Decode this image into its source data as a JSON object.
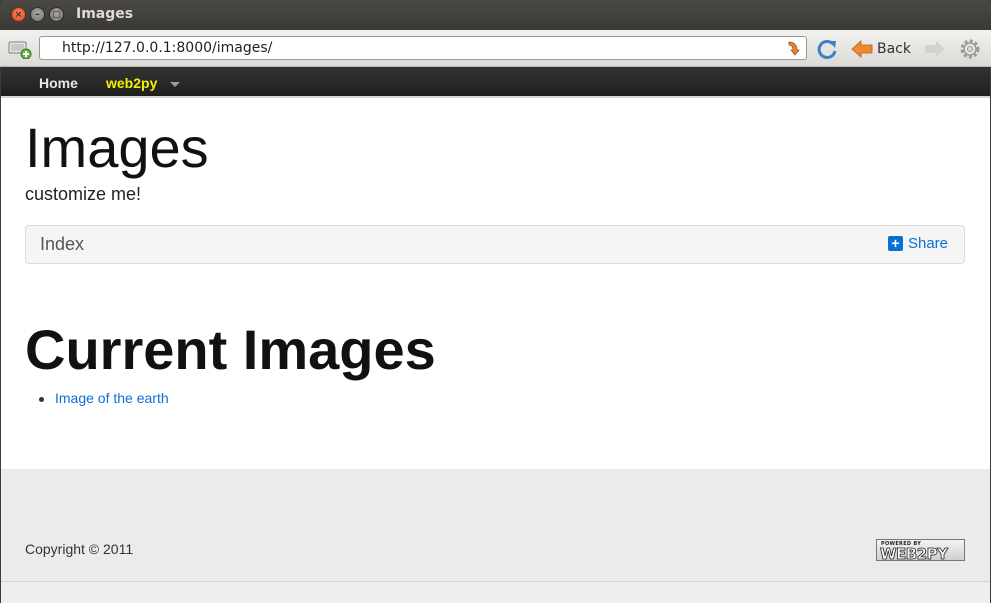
{
  "window": {
    "title": "Images"
  },
  "browser": {
    "url": "http://127.0.0.1:8000/images/",
    "back_label": "Back"
  },
  "navbar": {
    "home_label": "Home",
    "brand_label": "web2py"
  },
  "page": {
    "title": "Images",
    "subtitle": "customize me!",
    "breadcrumb": {
      "index_label": "Index",
      "share_label": "Share"
    },
    "section_heading": "Current Images",
    "images": [
      {
        "label": "Image of the earth"
      }
    ]
  },
  "footer": {
    "copyright": "Copyright © 2011",
    "badge_top": "POWERED BY",
    "badge_main": "WEB2PY"
  },
  "colors": {
    "link": "#0b6fd6",
    "brand": "#f5f000",
    "navbar_bg": "#2a2a2a",
    "footer_bg": "#ebebeb"
  }
}
